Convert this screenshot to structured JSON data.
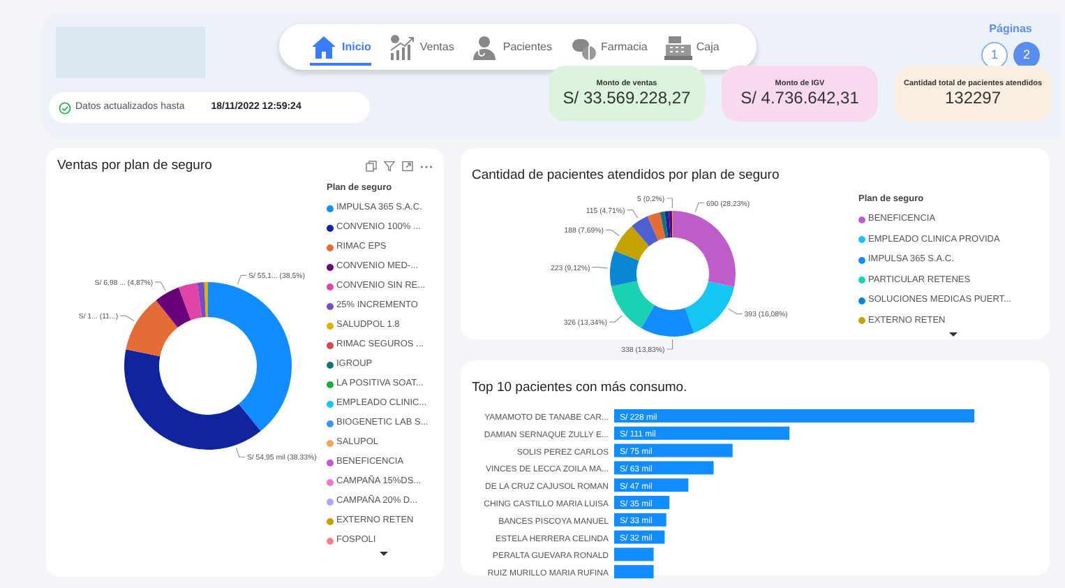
{
  "header": {
    "nav_tabs": [
      {
        "label": "Inicio",
        "selected": true,
        "kind": "home"
      },
      {
        "label": "Ventas",
        "selected": false,
        "kind": "sales"
      },
      {
        "label": "Pacientes",
        "selected": false,
        "kind": "patients"
      },
      {
        "label": "Farmacia",
        "selected": false,
        "kind": "pharmacy"
      },
      {
        "label": "Caja",
        "selected": false,
        "kind": "cash"
      }
    ],
    "update_status": {
      "label": "Datos actualizados hasta",
      "value": "18/11/2022 12:59:24"
    },
    "pages": {
      "title": "Páginas",
      "items": [
        {
          "label": "1",
          "selected": false
        },
        {
          "label": "2",
          "selected": true
        }
      ]
    },
    "kpis": [
      {
        "title": "Monto de ventas",
        "value": "S/ 33.569.228,27",
        "color": "#dcf4de"
      },
      {
        "title": "Monto de IGV",
        "value": "S/ 4.736.642,31",
        "color": "#f8d9ef"
      },
      {
        "title": "Cantidad total de pacientes atendidos",
        "value": "132297",
        "color": "#fcefe1"
      }
    ]
  },
  "sales_by_plan": {
    "legend_title": "Plan de seguro",
    "chart_data": {
      "type": "donut",
      "title": "Ventas por plan de seguro",
      "categories": [
        "IMPULSA 365 S.A.C.",
        "CONVENIO 100% ...",
        "RIMAC EPS",
        "CONVENIO MED-...",
        "CONVENIO SIN RE...",
        "25% INCREMENTO",
        "SALUDPOL 1.8",
        "RIMAC SEGUROS ...",
        "IGROUP",
        "LA POSITIVA SOAT...",
        "EMPLEADO CLINIC...",
        "BIOGENETIC LAB S...",
        "SALUPOL",
        "BENEFICENCIA",
        "CAMPAÑA 15%DS...",
        "CAMPAÑA 20% D...",
        "EXTERNO RETEN",
        "FOSPOLI"
      ],
      "values": [
        38.5,
        38.33,
        11,
        4.87,
        3.6,
        1.3,
        0.7,
        null,
        null,
        null,
        null,
        null,
        null,
        null,
        null,
        null,
        null,
        null
      ],
      "colors": [
        "#118dff",
        "#12239e",
        "#e66c37",
        "#6b007b",
        "#e044a7",
        "#744ec2",
        "#d9b300",
        "#d64550",
        "#197278",
        "#1aab40",
        "#15c6f4",
        "#4092ff",
        "#ffa058",
        "#be5dc9",
        "#f472d0",
        "#b5a1ff",
        "#c4a200",
        "#ff8080"
      ],
      "value_labels": [
        "S/ 55,1... (38,5%)",
        "S/ 54,95 mil (38,33%)",
        "S/ 1... (11...)",
        "S/ 6,98 ... (4,87%)",
        null,
        null,
        null,
        null,
        null,
        null,
        null,
        null,
        null,
        null,
        null,
        null,
        null,
        null
      ]
    }
  },
  "patients_by_plan": {
    "legend_title": "Plan de seguro",
    "chart_data": {
      "type": "donut",
      "title": "Cantidad de pacientes atendidos por plan de seguro",
      "categories": [
        "BENEFICENCIA",
        "EMPLEADO CLINICA PROVIDA",
        "IMPULSA 365 S.A.C.",
        "PARTICULAR RETENES",
        "SOLUCIONES MEDICAS PUERT...",
        "EXTERNO RETEN",
        null,
        null,
        null,
        null,
        null,
        null
      ],
      "values": [
        690,
        393,
        338,
        326,
        223,
        188,
        115,
        80,
        30,
        25,
        20,
        5
      ],
      "colors": [
        "#be5dc9",
        "#15c6f4",
        "#118dff",
        "#1bd1b4",
        "#0a86d4",
        "#c4a200",
        "#4e5fd0",
        "#e66c37",
        "#197278",
        "#12239e",
        "#6b007b",
        "#d9b300"
      ],
      "value_labels": [
        "690 (28,23%)",
        "393 (16,08%)",
        "338 (13,83%)",
        "326 (13,34%)",
        "223 (9,12%)",
        "188 (7,69%)",
        "115 (4,71%)",
        null,
        null,
        null,
        null,
        "5 (0,2%)"
      ]
    }
  },
  "top_patients": {
    "chart_data": {
      "type": "bar",
      "orientation": "horizontal",
      "title": "Top 10 pacientes con más consumo.",
      "categories": [
        "YAMAMOTO DE TANABE CAR...",
        "DAMIAN SERNAQUE ZULLY E...",
        "SOLIS PEREZ CARLOS",
        "VINCES DE LECCA ZOILA MA...",
        "DE LA CRUZ CAJUSOL ROMAN",
        "CHING CASTILLO MARIA LUISA",
        "BANCES PISCOYA MANUEL",
        "ESTELA HERRERA CELINDA",
        "PERALTA GUEVARA RONALD",
        "RUIZ MURILLO MARIA RUFINA"
      ],
      "values": [
        228,
        111,
        75,
        63,
        47,
        35,
        33,
        32,
        25,
        25
      ],
      "value_labels": [
        "S/ 228 mil",
        "S/ 111 mil",
        "S/ 75 mil",
        "S/ 63 mil",
        "S/ 47 mil",
        "S/ 35 mil",
        "S/ 33 mil",
        "S/ 32 mil",
        null,
        null
      ]
    }
  }
}
